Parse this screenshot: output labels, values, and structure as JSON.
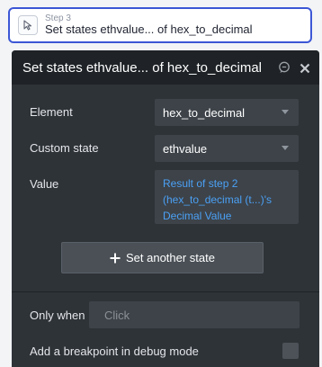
{
  "step": {
    "label": "Step 3",
    "title": "Set states ethvalue... of hex_to_decimal"
  },
  "panel": {
    "title": "Set states ethvalue... of hex_to_decimal",
    "element_label": "Element",
    "element_value": "hex_to_decimal",
    "custom_state_label": "Custom state",
    "custom_state_value": "ethvalue",
    "value_label": "Value",
    "value_line1": "Result of step 2",
    "value_line2": "(hex_to_decimal (t...)'s",
    "value_line3": "Decimal Value",
    "set_another_state_label": "Set another state",
    "only_when_label": "Only when",
    "only_when_placeholder": "Click",
    "breakpoint_label": "Add a breakpoint in debug mode"
  },
  "icons": {
    "step": "cursor-arrow-icon",
    "comment": "comment-icon",
    "close": "close-icon"
  },
  "colors": {
    "accent": "#3c57d6",
    "panel_bg": "#2e3338",
    "link_blue": "#4ba0f5"
  }
}
